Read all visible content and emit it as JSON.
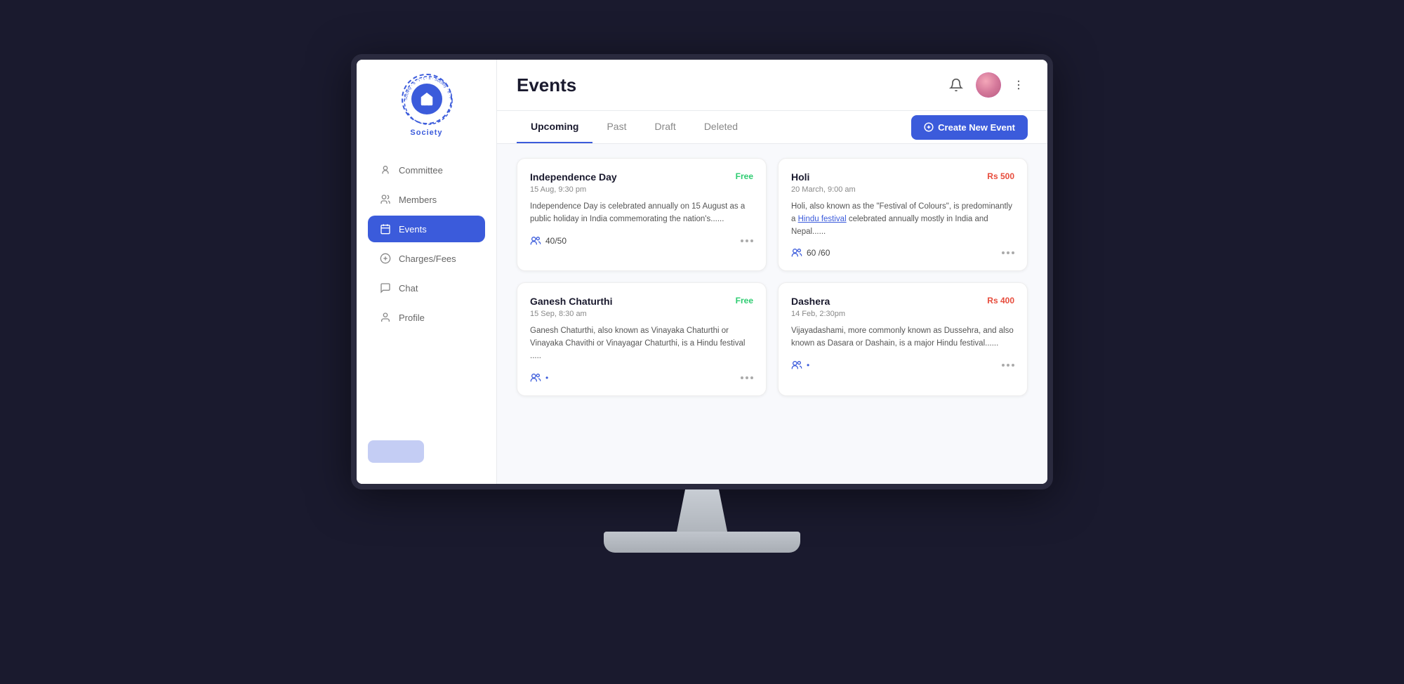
{
  "app": {
    "title": "Society",
    "logo_text": "Society"
  },
  "header": {
    "title": "Events"
  },
  "tabs": {
    "items": [
      {
        "id": "upcoming",
        "label": "Upcoming",
        "active": true
      },
      {
        "id": "past",
        "label": "Past",
        "active": false
      },
      {
        "id": "draft",
        "label": "Draft",
        "active": false
      },
      {
        "id": "deleted",
        "label": "Deleted",
        "active": false
      }
    ],
    "create_button": "Create New Event"
  },
  "nav": {
    "items": [
      {
        "id": "committee",
        "label": "Committee",
        "active": false
      },
      {
        "id": "members",
        "label": "Members",
        "active": false
      },
      {
        "id": "events",
        "label": "Events",
        "active": true
      },
      {
        "id": "charges",
        "label": "Charges/Fees",
        "active": false
      },
      {
        "id": "chat",
        "label": "Chat",
        "active": false
      },
      {
        "id": "profile",
        "label": "Profile",
        "active": false
      }
    ]
  },
  "events": [
    {
      "id": "independence-day",
      "title": "Independence Day",
      "date": "15 Aug, 9:30 pm",
      "badge": "Free",
      "badge_type": "free",
      "description": "Independence Day is celebrated annually on 15 August as a public holiday in India commemorating the nation's......",
      "attendees": "40/50"
    },
    {
      "id": "holi",
      "title": "Holi",
      "date": "20 March, 9:00 am",
      "badge": "Rs 500",
      "badge_type": "paid",
      "description": "Holi, also known as the \"Festival of Colours\", is predominantly a Hindu festival celebrated annually mostly in India and Nepal......",
      "attendees": "60 /60"
    },
    {
      "id": "ganesh-chaturthi",
      "title": "Ganesh Chaturthi",
      "date": "15 Sep, 8:30 am",
      "badge": "Free",
      "badge_type": "free",
      "description": "Ganesh Chaturthi, also known as Vinayaka Chaturthi or Vinayaka Chavithi or Vinayagar Chaturthi, is a Hindu festival .....",
      "attendees": ""
    },
    {
      "id": "dashera",
      "title": "Dashera",
      "date": "14 Feb, 2:30pm",
      "badge": "Rs 400",
      "badge_type": "paid",
      "description": "Vijayadashami, more commonly known as Dussehra, and also known as Dasara or Dashain, is a major Hindu festival......",
      "attendees": ""
    }
  ]
}
